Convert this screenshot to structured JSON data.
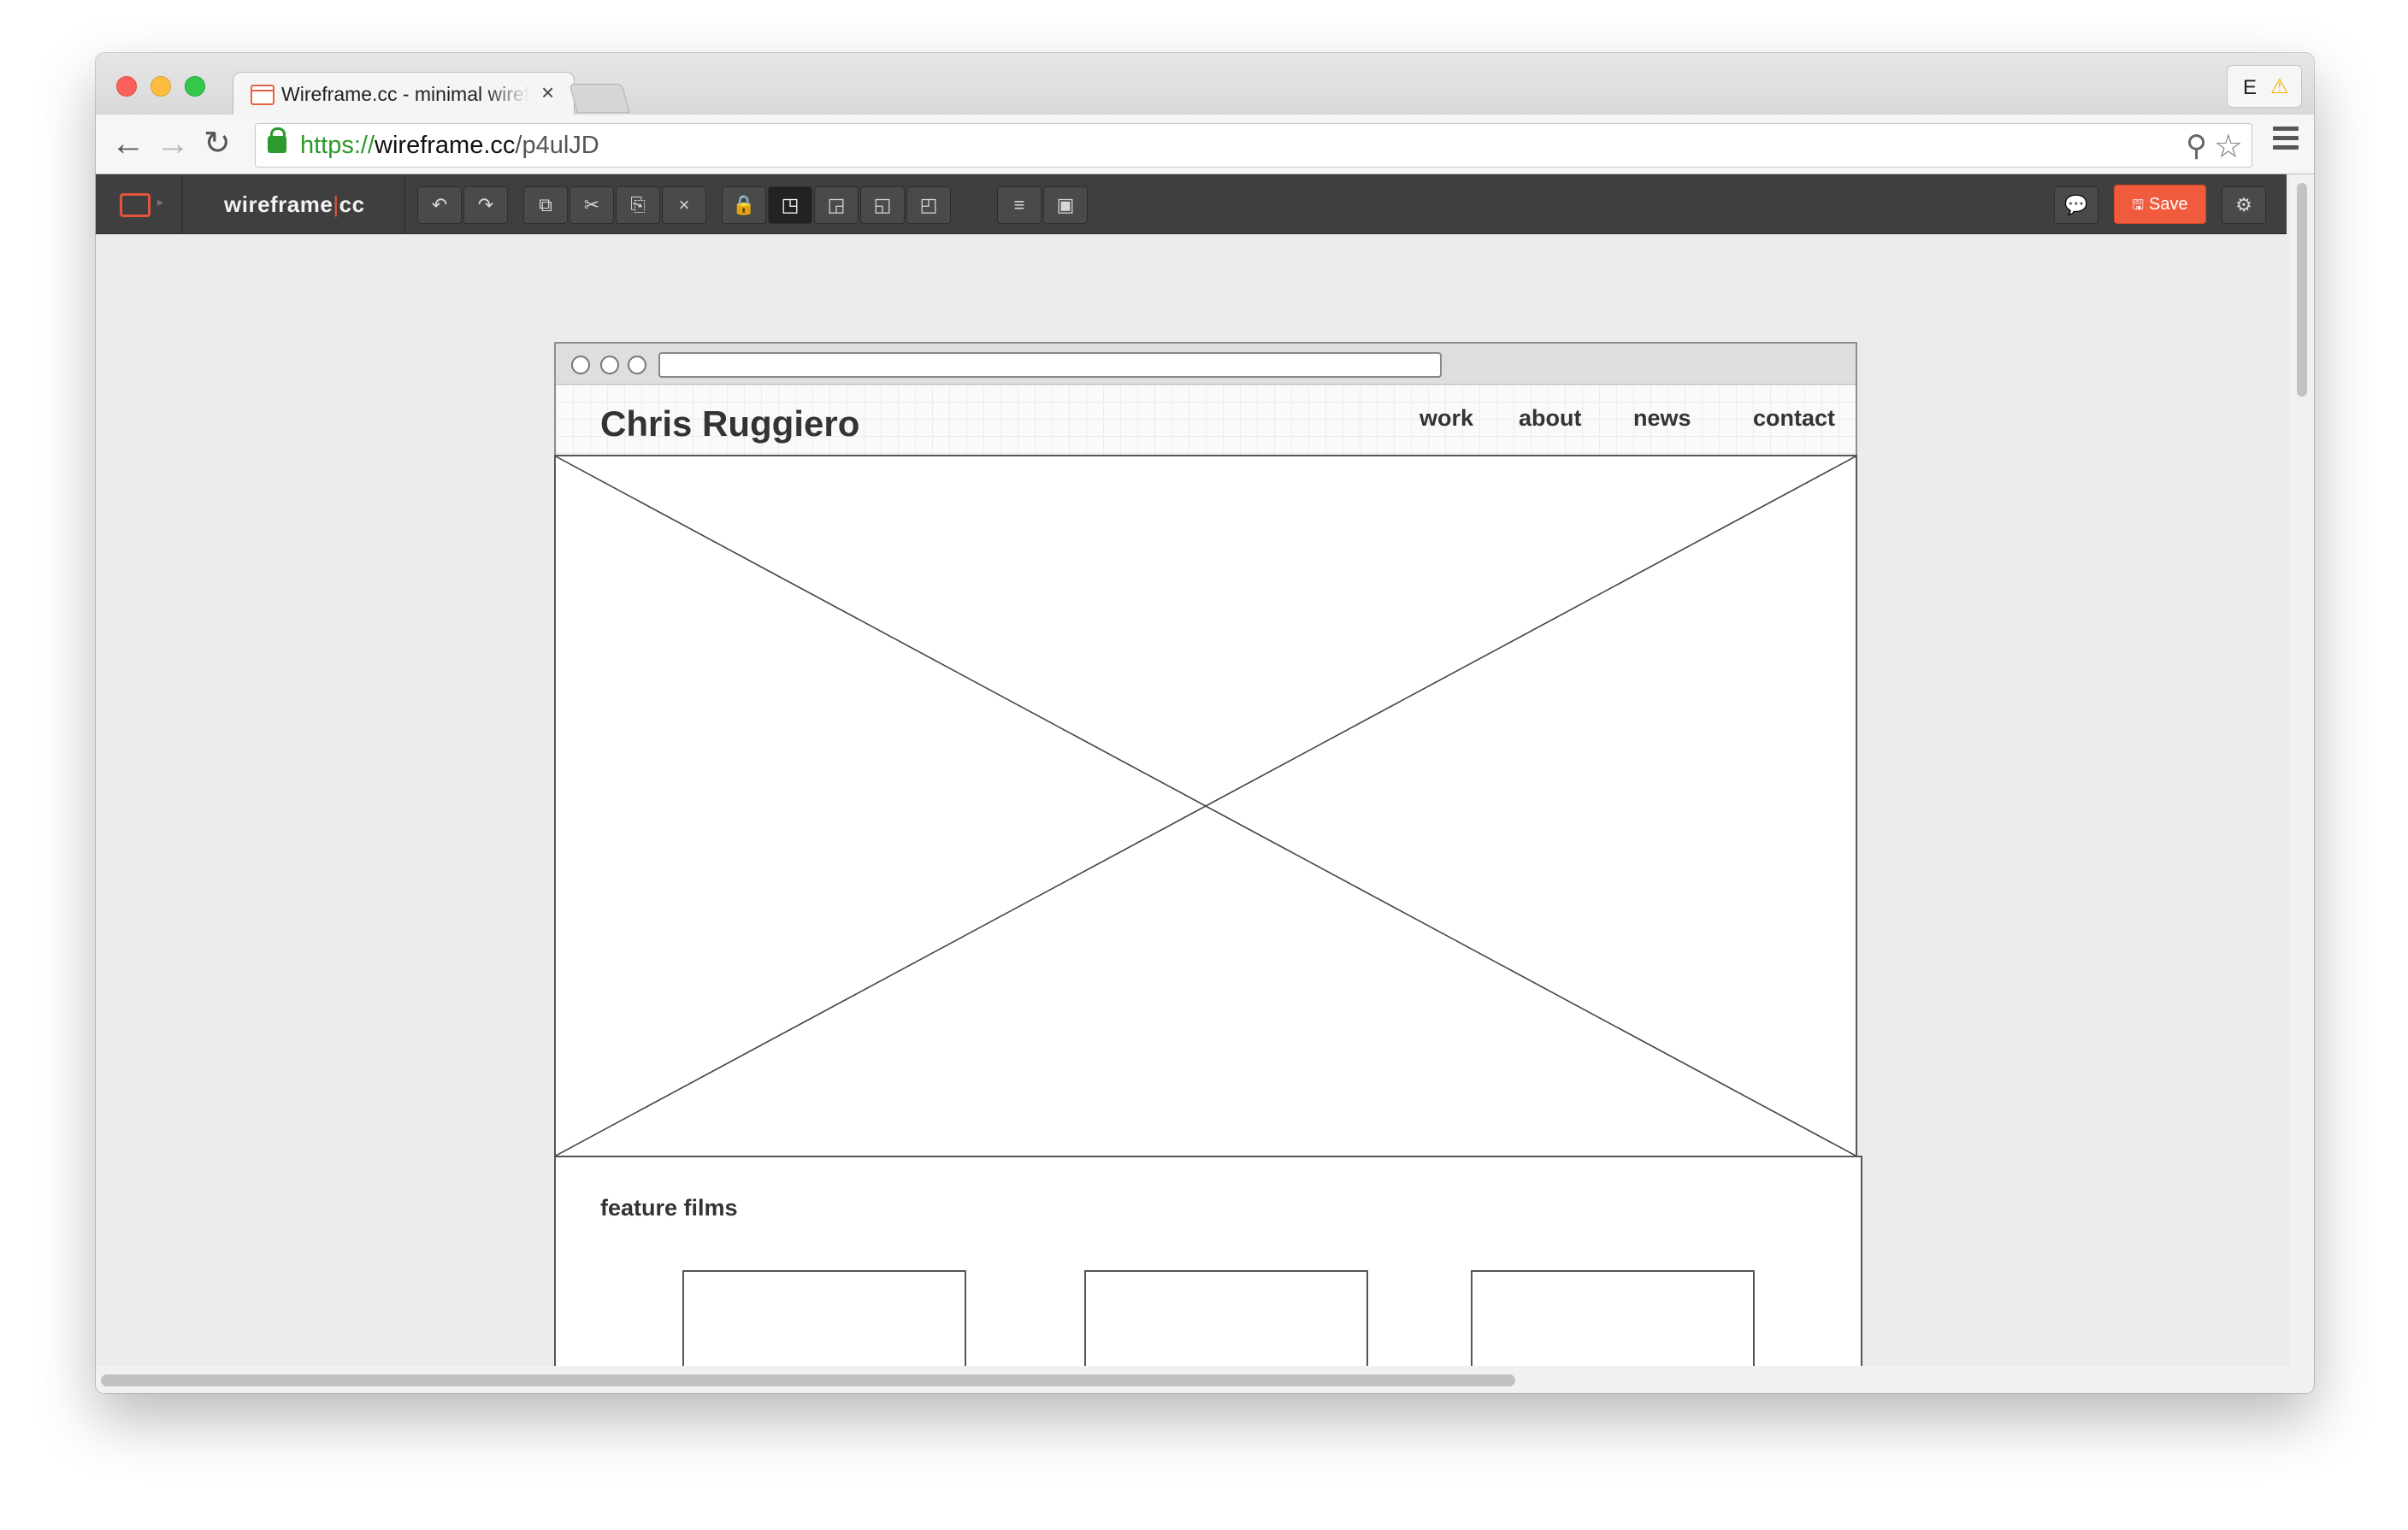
{
  "browser": {
    "tab_title": "Wireframe.cc - minimal wireframing tool",
    "tab_close": "×",
    "extension_letter": "E",
    "extension_warning": "⚠",
    "url_scheme": "https://",
    "url_host": "wireframe.cc",
    "url_path": "/p4ulJD",
    "icons": [
      "back-arrow-icon",
      "forward-arrow-icon",
      "reload-icon",
      "lock-icon",
      "zoom-icon",
      "star-icon",
      "menu-icon"
    ]
  },
  "app": {
    "brand_left": "wireframe",
    "brand_pipe": "|",
    "brand_right": "cc",
    "toolbar_glyphs": {
      "undo": "↶",
      "redo": "↷",
      "copy": "⧉",
      "cut": "✂",
      "paste": "⎘",
      "delete": "×",
      "lock": "🔒",
      "bring_front": "◳",
      "bring_forward": "◲",
      "send_backward": "◱",
      "send_back": "◰",
      "align": "≡",
      "group": "▣",
      "comment": "💬",
      "settings": "⚙"
    },
    "save_label": "Save",
    "save_glyph": "🖫",
    "accent_color": "#f05b3d"
  },
  "wireframe": {
    "site_title": "Chris Ruggiero",
    "nav": [
      "work",
      "about",
      "news",
      "contact"
    ],
    "section_title": "feature films"
  }
}
